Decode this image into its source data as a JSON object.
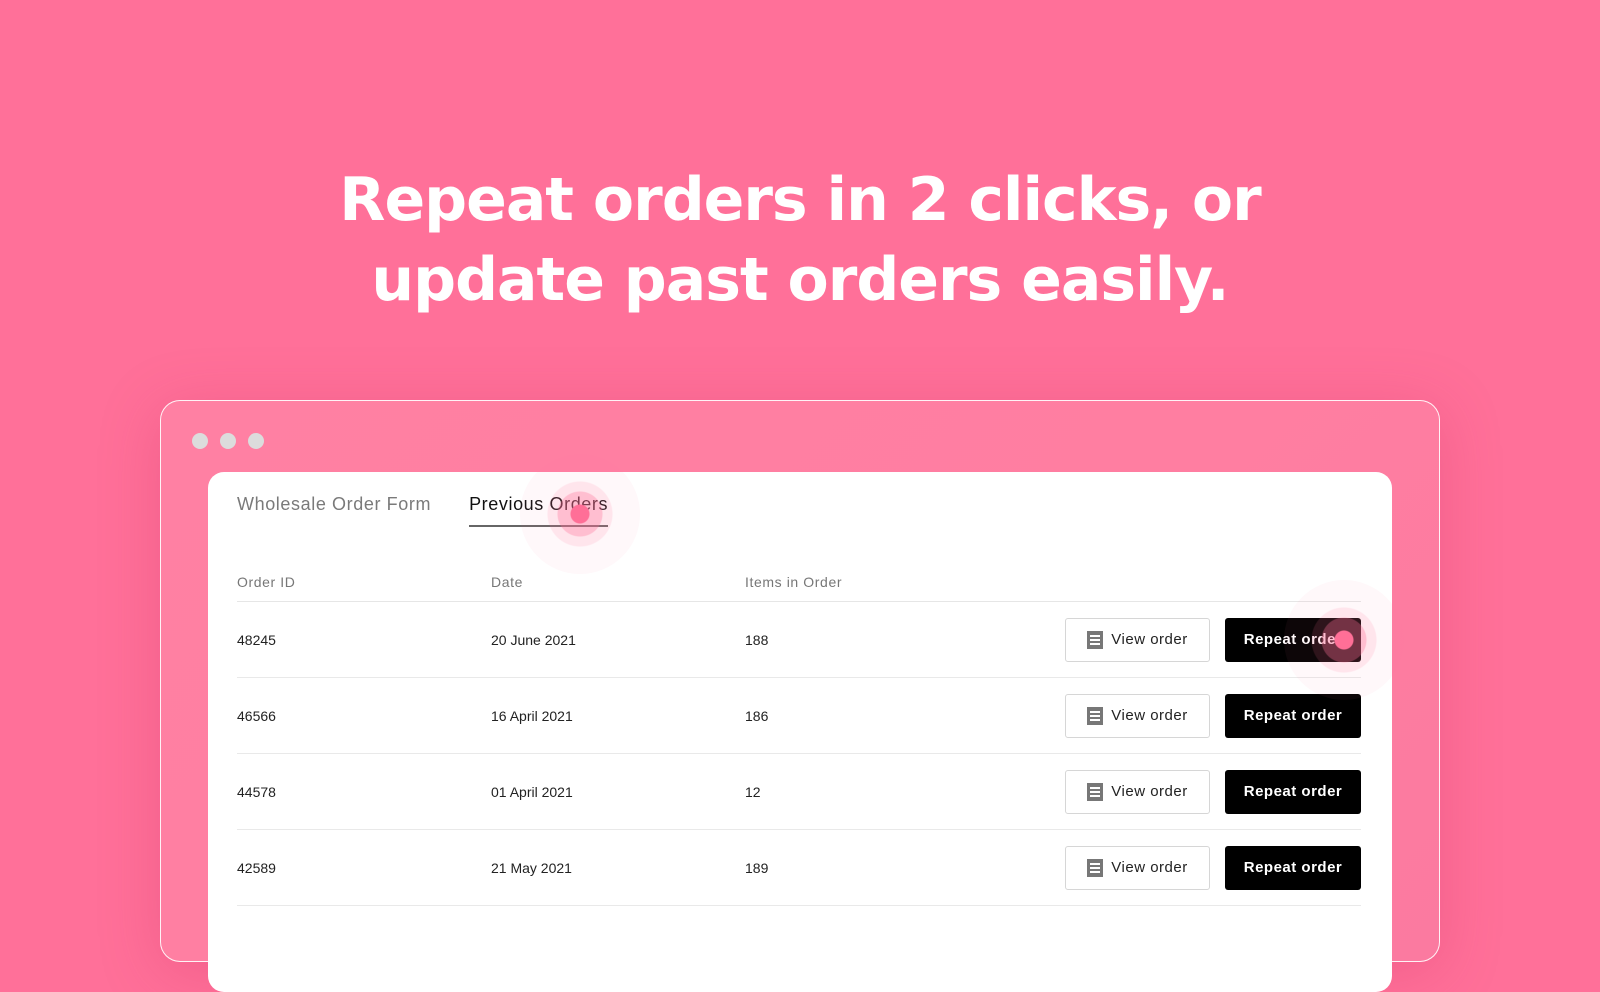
{
  "headline": {
    "line1": "Repeat orders in 2 clicks, or",
    "line2": "update past orders easily."
  },
  "colors": {
    "background": "#ff7099",
    "frame": "#ff80a3",
    "primary_button": "#000000",
    "click_indicator": "#ff6f97"
  },
  "tabs": [
    {
      "label": "Wholesale Order Form",
      "active": false
    },
    {
      "label": "Previous Orders",
      "active": true
    }
  ],
  "table": {
    "columns": [
      "Order ID",
      "Date",
      "Items in Order"
    ],
    "rows": [
      {
        "order_id": "48245",
        "date": "20 June 2021",
        "items": "188"
      },
      {
        "order_id": "46566",
        "date": "16 April 2021",
        "items": "186"
      },
      {
        "order_id": "44578",
        "date": "01 April 2021",
        "items": "12"
      },
      {
        "order_id": "42589",
        "date": "21 May 2021",
        "items": "189"
      }
    ],
    "view_label": "View order",
    "view_icon": "receipt-icon",
    "repeat_label": "Repeat order"
  }
}
